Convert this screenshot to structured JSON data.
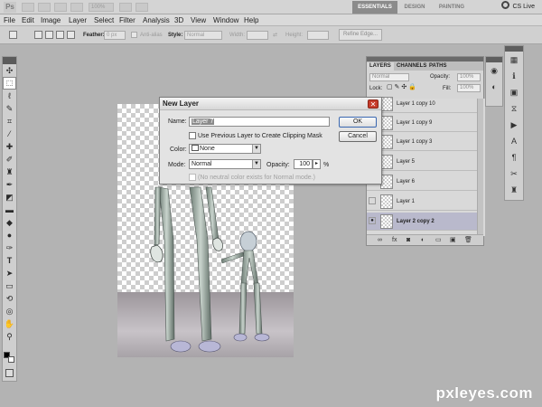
{
  "appbar": {
    "logo": "Ps",
    "zoom": "100%",
    "workspaces": [
      "ESSENTIALS",
      "DESIGN",
      "PAINTING"
    ],
    "cs_live": "CS Live"
  },
  "menu": [
    "File",
    "Edit",
    "Image",
    "Layer",
    "Select",
    "Filter",
    "Analysis",
    "3D",
    "View",
    "Window",
    "Help"
  ],
  "options": {
    "feather_label": "Feather:",
    "feather_value": "0 px",
    "antialias_label": "Anti-alias",
    "style_label": "Style:",
    "style_value": "Normal",
    "width_label": "Width:",
    "height_label": "Height:",
    "refine_edge": "Refine Edge..."
  },
  "toolbox": {
    "tools": [
      "move-tool",
      "marquee-tool",
      "lasso-tool",
      "quick-selection-tool",
      "crop-tool",
      "eyedropper-tool",
      "healing-brush-tool",
      "brush-tool",
      "clone-stamp-tool",
      "history-brush-tool",
      "eraser-tool",
      "gradient-tool",
      "blur-tool",
      "dodge-tool",
      "pen-tool",
      "type-tool",
      "path-selection-tool",
      "direct-selection-tool",
      "shape-tool",
      "3d-rotate-tool",
      "3d-orbit-tool",
      "hand-tool",
      "zoom-tool"
    ]
  },
  "dialog": {
    "title": "New Layer",
    "name_label": "Name:",
    "name_value": "Layer 7",
    "clipping_label": "Use Previous Layer to Create Clipping Mask",
    "color_label": "Color:",
    "color_value": "None",
    "mode_label": "Mode:",
    "mode_value": "Normal",
    "opacity_label": "Opacity:",
    "opacity_value": "100",
    "opacity_unit": "%",
    "neutral_label": "(No neutral color exists for Normal mode.)",
    "ok": "OK",
    "cancel": "Cancel"
  },
  "layers": {
    "tabs": [
      "LAYERS",
      "CHANNELS",
      "PATHS"
    ],
    "blend_mode": "Normal",
    "opacity_label": "Opacity:",
    "opacity_value": "100%",
    "lock_label": "Lock:",
    "fill_label": "Fill:",
    "fill_value": "100%",
    "items": [
      {
        "name": "Layer 1 copy 10",
        "visible": false
      },
      {
        "name": "Layer 1 copy 9",
        "visible": false
      },
      {
        "name": "Layer 1 copy 3",
        "visible": false
      },
      {
        "name": "Layer 5",
        "visible": false
      },
      {
        "name": "Layer 6",
        "visible": false
      },
      {
        "name": "Layer 1",
        "visible": false
      },
      {
        "name": "Layer 2 copy 2",
        "visible": true,
        "active": true
      }
    ]
  },
  "watermark": "pxleyes.com"
}
